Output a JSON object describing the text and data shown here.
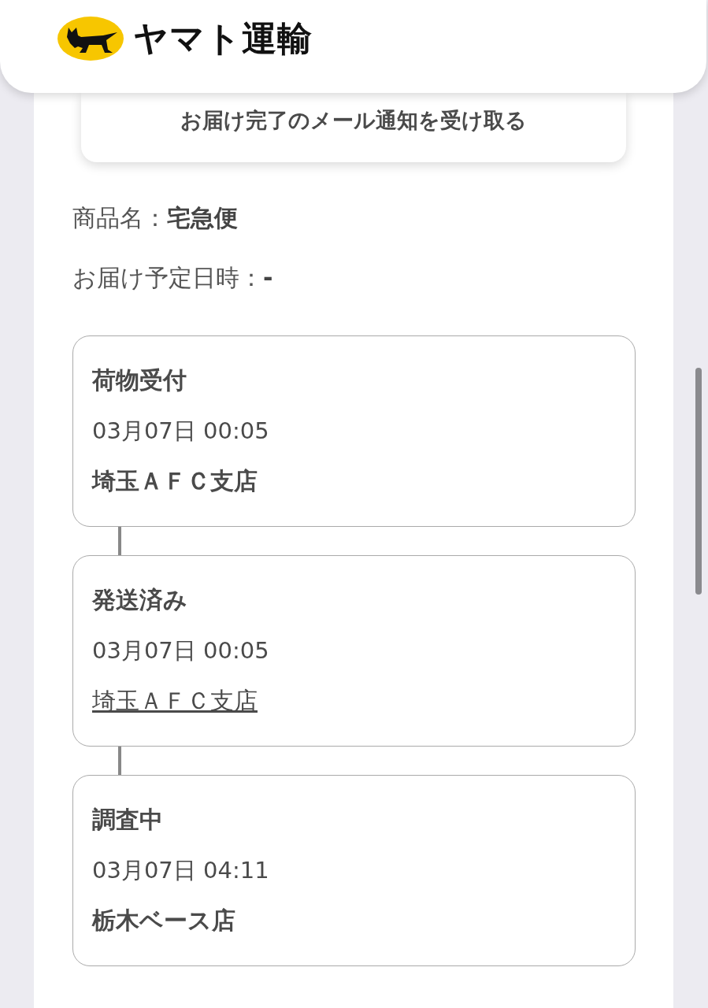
{
  "header": {
    "logo_text": "ヤマト運輸"
  },
  "notify_button": {
    "label": "お届け完了のメール通知を受け取る"
  },
  "details": [
    {
      "label": "商品名：",
      "value": "宅急便"
    },
    {
      "label": "お届け予定日時：",
      "value": "-"
    }
  ],
  "events": [
    {
      "status": "荷物受付",
      "datetime": "03月07日 00:05",
      "place": "埼玉ＡＦＣ支店",
      "place_link": false
    },
    {
      "status": "発送済み",
      "datetime": "03月07日 00:05",
      "place": "埼玉ＡＦＣ支店",
      "place_link": true
    },
    {
      "status": "調査中",
      "datetime": "03月07日 04:11",
      "place": "栃木ベース店",
      "place_link": false
    }
  ]
}
